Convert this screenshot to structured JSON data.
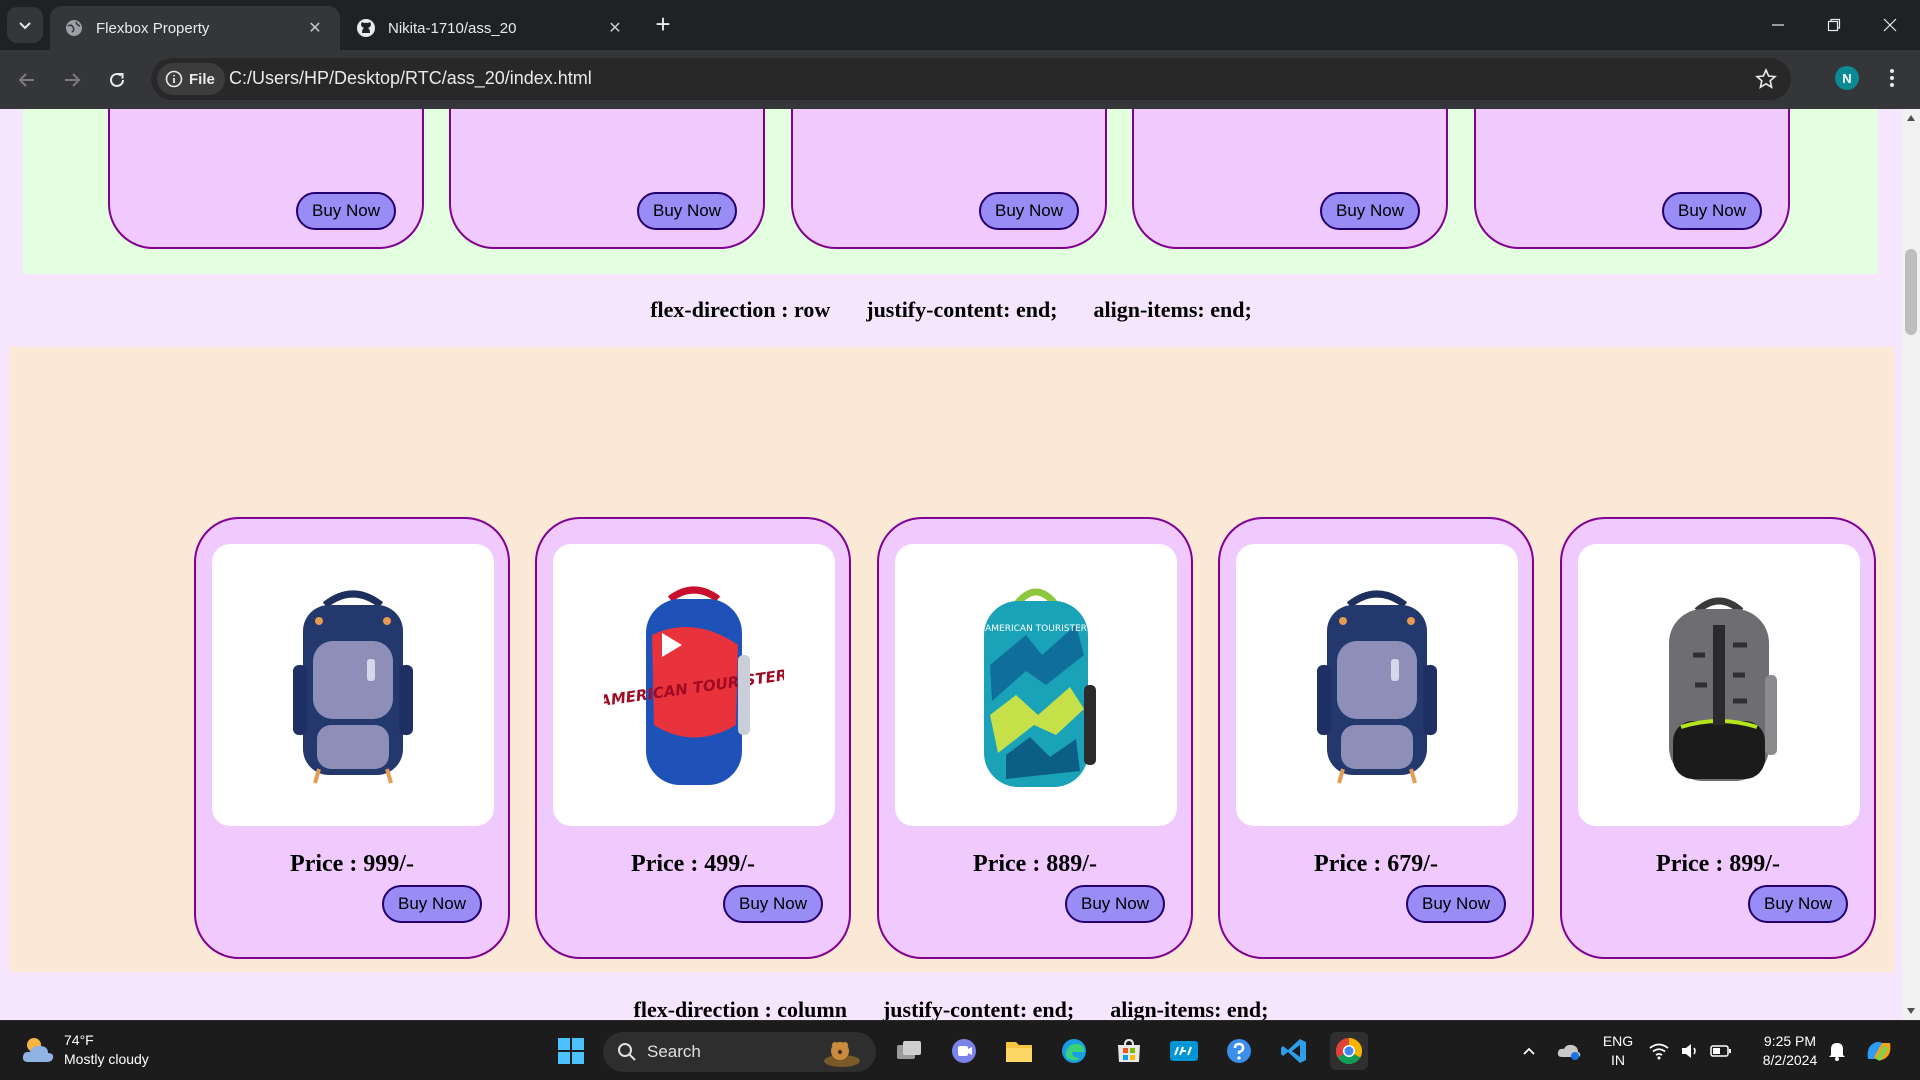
{
  "browser": {
    "tabs": [
      {
        "title": "Flexbox Property",
        "active": true,
        "icon": "globe-icon"
      },
      {
        "title": "Nikita-1710/ass_20",
        "active": false,
        "icon": "github-icon"
      }
    ],
    "site_chip": "File",
    "url": "C:/Users/HP/Desktop/RTC/ass_20/index.html",
    "profile_initial": "N"
  },
  "page": {
    "top_section": {
      "buttons": [
        "Buy Now",
        "Buy Now",
        "Buy Now",
        "Buy Now",
        "Buy Now"
      ]
    },
    "label_row_1": {
      "direction": "flex-direction : row",
      "justify": "justify-content: end;",
      "align": "align-items: end;"
    },
    "products": [
      {
        "price": "Price : 999/-",
        "button": "Buy Now",
        "bag": "navy-grey-backpack"
      },
      {
        "price": "Price : 499/-",
        "button": "Buy Now",
        "bag": "red-blue-american-tourister-backpack"
      },
      {
        "price": "Price : 889/-",
        "button": "Buy Now",
        "bag": "teal-pattern-backpack"
      },
      {
        "price": "Price : 679/-",
        "button": "Buy Now",
        "bag": "navy-grey-backpack"
      },
      {
        "price": "Price : 899/-",
        "button": "Buy Now",
        "bag": "grey-black-backpack"
      }
    ],
    "bag_text": {
      "red_brand": "AMERICAN TOURISTER",
      "teal_brand": "AMERICAN TOURISTER"
    },
    "label_row_2": {
      "direction": "flex-direction : column",
      "justify": "justify-content: end;",
      "align": "align-items: end;"
    }
  },
  "taskbar": {
    "weather_temp": "74°F",
    "weather_desc": "Mostly cloudy",
    "search_label": "Search",
    "lang_top": "ENG",
    "lang_bottom": "IN",
    "time": "9:25 PM",
    "date": "8/2/2024"
  },
  "colors": {
    "card_bg": "#f0caff",
    "card_border": "#800091",
    "button_bg": "#9a8cf5",
    "green_section": "#e4ffe0",
    "peach_section": "#fbe9d6",
    "page_bg": "#f6e6fd"
  }
}
